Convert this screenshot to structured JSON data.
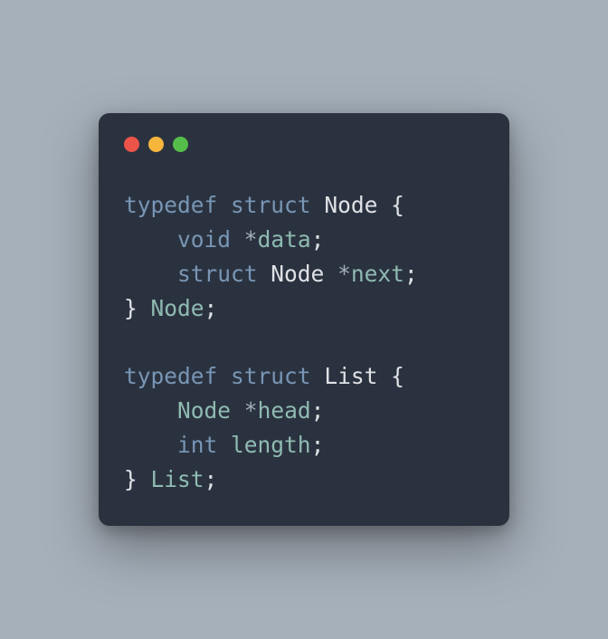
{
  "colors": {
    "page_bg": "#a6b0ba",
    "window_bg": "#2b323f",
    "dot_red": "#ec5349",
    "dot_yellow": "#f6b63c",
    "dot_green": "#55be4a",
    "keyword": "#7896b5",
    "type_text": "#dfe2e6",
    "field_text": "#8fbbb2",
    "star_text": "#a4adbb"
  },
  "code": {
    "lines": [
      [
        {
          "t": "typedef",
          "c": "kw"
        },
        {
          "t": " ",
          "c": "type"
        },
        {
          "t": "struct",
          "c": "kw"
        },
        {
          "t": " ",
          "c": "type"
        },
        {
          "t": "Node",
          "c": "type"
        },
        {
          "t": " {",
          "c": "type"
        }
      ],
      [
        {
          "t": "    ",
          "c": "type"
        },
        {
          "t": "void",
          "c": "kw"
        },
        {
          "t": " ",
          "c": "type"
        },
        {
          "t": "*",
          "c": "star"
        },
        {
          "t": "data",
          "c": "field"
        },
        {
          "t": ";",
          "c": "type"
        }
      ],
      [
        {
          "t": "    ",
          "c": "type"
        },
        {
          "t": "struct",
          "c": "kw"
        },
        {
          "t": " ",
          "c": "type"
        },
        {
          "t": "Node",
          "c": "type"
        },
        {
          "t": " ",
          "c": "type"
        },
        {
          "t": "*",
          "c": "star"
        },
        {
          "t": "next",
          "c": "field"
        },
        {
          "t": ";",
          "c": "type"
        }
      ],
      [
        {
          "t": "} ",
          "c": "type"
        },
        {
          "t": "Node",
          "c": "field"
        },
        {
          "t": ";",
          "c": "type"
        }
      ],
      [
        {
          "t": "",
          "c": "type"
        }
      ],
      [
        {
          "t": "typedef",
          "c": "kw"
        },
        {
          "t": " ",
          "c": "type"
        },
        {
          "t": "struct",
          "c": "kw"
        },
        {
          "t": " ",
          "c": "type"
        },
        {
          "t": "List",
          "c": "type"
        },
        {
          "t": " {",
          "c": "type"
        }
      ],
      [
        {
          "t": "    ",
          "c": "type"
        },
        {
          "t": "Node",
          "c": "field"
        },
        {
          "t": " ",
          "c": "type"
        },
        {
          "t": "*",
          "c": "star"
        },
        {
          "t": "head",
          "c": "field"
        },
        {
          "t": ";",
          "c": "type"
        }
      ],
      [
        {
          "t": "    ",
          "c": "type"
        },
        {
          "t": "int",
          "c": "kw"
        },
        {
          "t": " ",
          "c": "type"
        },
        {
          "t": "length",
          "c": "field"
        },
        {
          "t": ";",
          "c": "type"
        }
      ],
      [
        {
          "t": "} ",
          "c": "type"
        },
        {
          "t": "List",
          "c": "field"
        },
        {
          "t": ";",
          "c": "type"
        }
      ]
    ]
  }
}
